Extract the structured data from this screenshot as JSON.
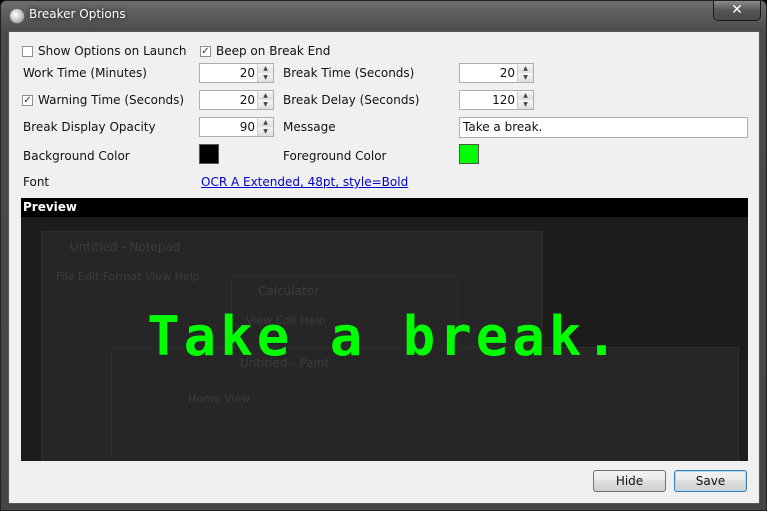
{
  "window": {
    "title": "Breaker Options",
    "close_glyph": "✕"
  },
  "options": {
    "show_on_launch": {
      "label": "Show Options on Launch",
      "checked": false
    },
    "beep_on_break_end": {
      "label": "Beep on Break End",
      "checked": true
    },
    "work_time": {
      "label": "Work Time (Minutes)",
      "value": "20"
    },
    "break_time": {
      "label": "Break Time (Seconds)",
      "value": "20"
    },
    "warning_time": {
      "label": "Warning Time (Seconds)",
      "value": "20",
      "checked": true
    },
    "break_delay": {
      "label": "Break Delay (Seconds)",
      "value": "120"
    },
    "opacity": {
      "label": "Break Display Opacity",
      "value": "90"
    },
    "message": {
      "label": "Message",
      "value": "Take a break."
    },
    "background_color": {
      "label": "Background Color",
      "color": "#000000"
    },
    "foreground_color": {
      "label": "Foreground Color",
      "color": "#00ff00"
    },
    "font": {
      "label": "Font",
      "link": "OCR A Extended, 48pt, style=Bold"
    }
  },
  "preview": {
    "header": "Preview",
    "message": "Take a break.",
    "ghost_windows": {
      "notepad": {
        "title": "Untitled - Notepad",
        "menu": "File   Edit   Format   View   Help"
      },
      "calculator": {
        "title": "Calculator",
        "menu": "View   Edit   Help"
      },
      "paint": {
        "title": "Untitled - Paint",
        "tabs": "Home      View"
      }
    }
  },
  "buttons": {
    "hide": "Hide",
    "save": "Save"
  },
  "check_glyph": "✓",
  "spin_up_glyph": "▲",
  "spin_down_glyph": "▼",
  "colors": {
    "message_text": "#00ff00",
    "link": "#0000cc"
  }
}
